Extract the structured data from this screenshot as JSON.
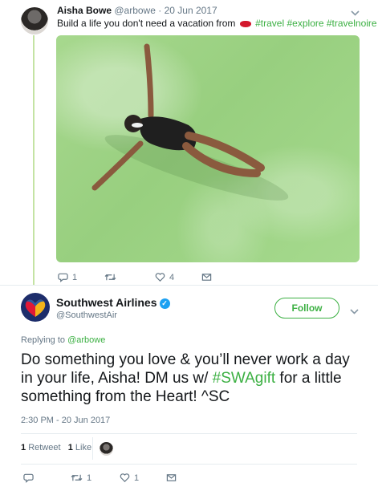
{
  "parent_tweet": {
    "name": "Aisha Bowe",
    "handle": "@arbowe",
    "separator": "·",
    "date": "20 Jun 2017",
    "text_before": "Build a life you don't need a vacation from",
    "hashtags": [
      "#travel",
      "#explore",
      "#travelnoire"
    ],
    "reply_count": "1",
    "retweet_count": "",
    "like_count": "4"
  },
  "main_tweet": {
    "name": "Southwest Airlines",
    "verified_mark": "✓",
    "handle": "@SouthwestAir",
    "follow_label": "Follow",
    "replying_prefix": "Replying to",
    "replying_handle": "@arbowe",
    "text_part1": "Do something you love & you’ll never work a day in your life, Aisha! DM us w/ ",
    "hashtag": "#SWAgift",
    "text_part2": " for a little something from the Heart! ^SC",
    "timestamp": "2:30 PM - 20 Jun 2017",
    "retweet_count": "1",
    "retweet_label": "Retweet",
    "like_count": "1",
    "like_label": "Like",
    "action_retweet_count": "1",
    "action_like_count": "1"
  },
  "colors": {
    "accent": "#3cb043",
    "thread_line": "#c4e3a4",
    "muted": "#657786",
    "brand_navy": "#1d2d6b"
  },
  "icons": {
    "reply": "reply-icon",
    "retweet": "retweet-icon",
    "like": "heart-icon",
    "dm": "envelope-icon",
    "caret": "chevron-down-icon",
    "lips": "kiss-mark-emoji"
  }
}
